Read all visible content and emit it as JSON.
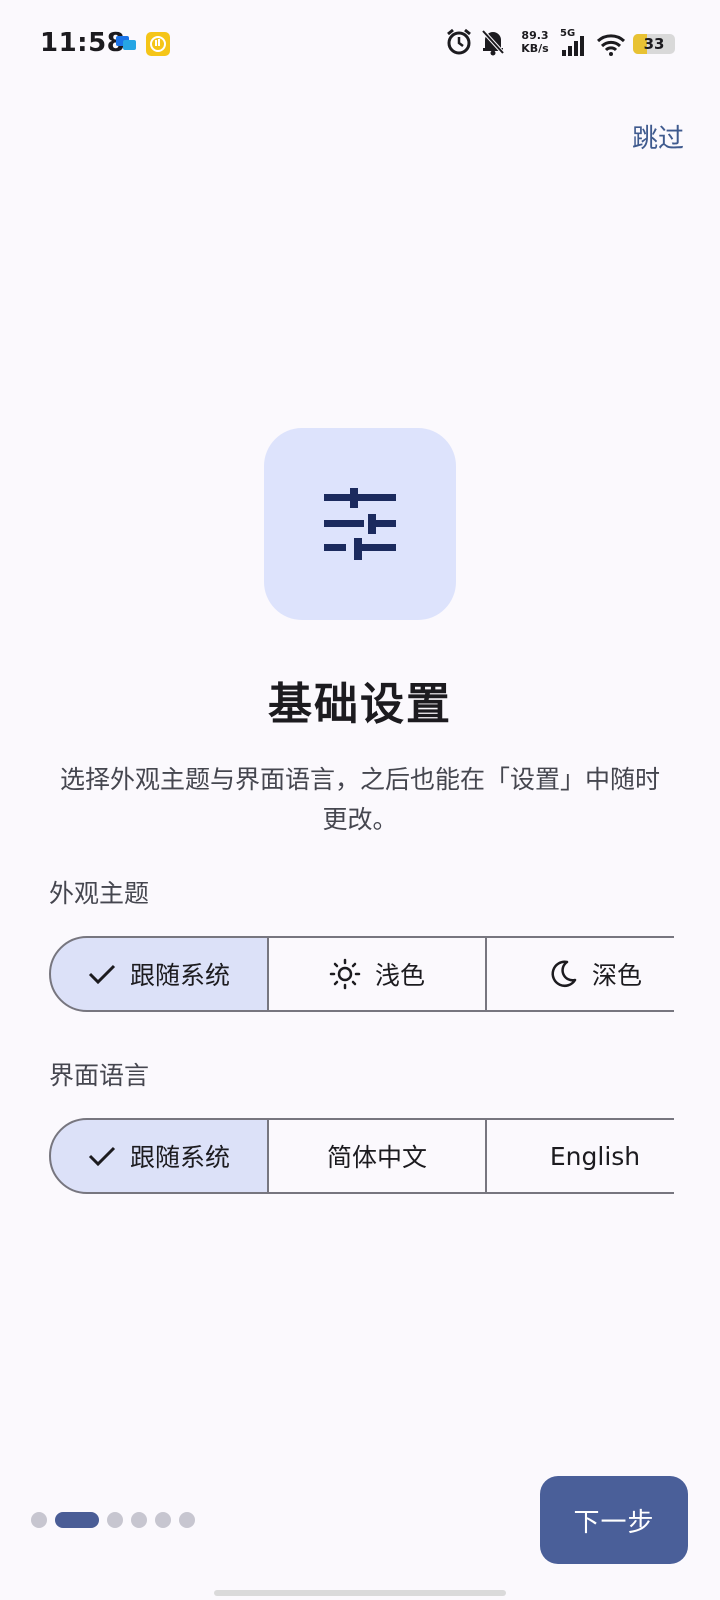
{
  "status_bar": {
    "time": "11:58",
    "net_speed_value": "89.3",
    "net_speed_unit": "KB/s",
    "network_type": "5G",
    "battery_level": "33",
    "icons": [
      "chat-notification-icon",
      "hand-app-icon",
      "alarm-icon",
      "bell-off-icon",
      "signal-icon",
      "wifi-icon",
      "battery-icon"
    ]
  },
  "header": {
    "skip_label": "跳过"
  },
  "hero": {
    "icon": "sliders-icon",
    "title": "基础设置"
  },
  "subtitle": "选择外观主题与界面语言，之后也能在「设置」中随时更改。",
  "theme_section": {
    "label": "外观主题",
    "options": [
      {
        "label": "跟随系统",
        "icon": "check-icon",
        "selected": true
      },
      {
        "label": "浅色",
        "icon": "sun-icon",
        "selected": false
      },
      {
        "label": "深色",
        "icon": "moon-icon",
        "selected": false
      }
    ]
  },
  "language_section": {
    "label": "界面语言",
    "options": [
      {
        "label": "跟随系统",
        "icon": "check-icon",
        "selected": true
      },
      {
        "label": "简体中文",
        "selected": false
      },
      {
        "label": "English",
        "selected": false
      }
    ]
  },
  "pager": {
    "total": 6,
    "current": 2
  },
  "footer": {
    "next_label": "下一步"
  },
  "colors": {
    "background": "#fbf9fd",
    "accent": "#4a5f99",
    "selected_segment": "#dce1f8",
    "hero_icon_bg": "#dde3fc",
    "skip_text": "#3f5a8e"
  }
}
